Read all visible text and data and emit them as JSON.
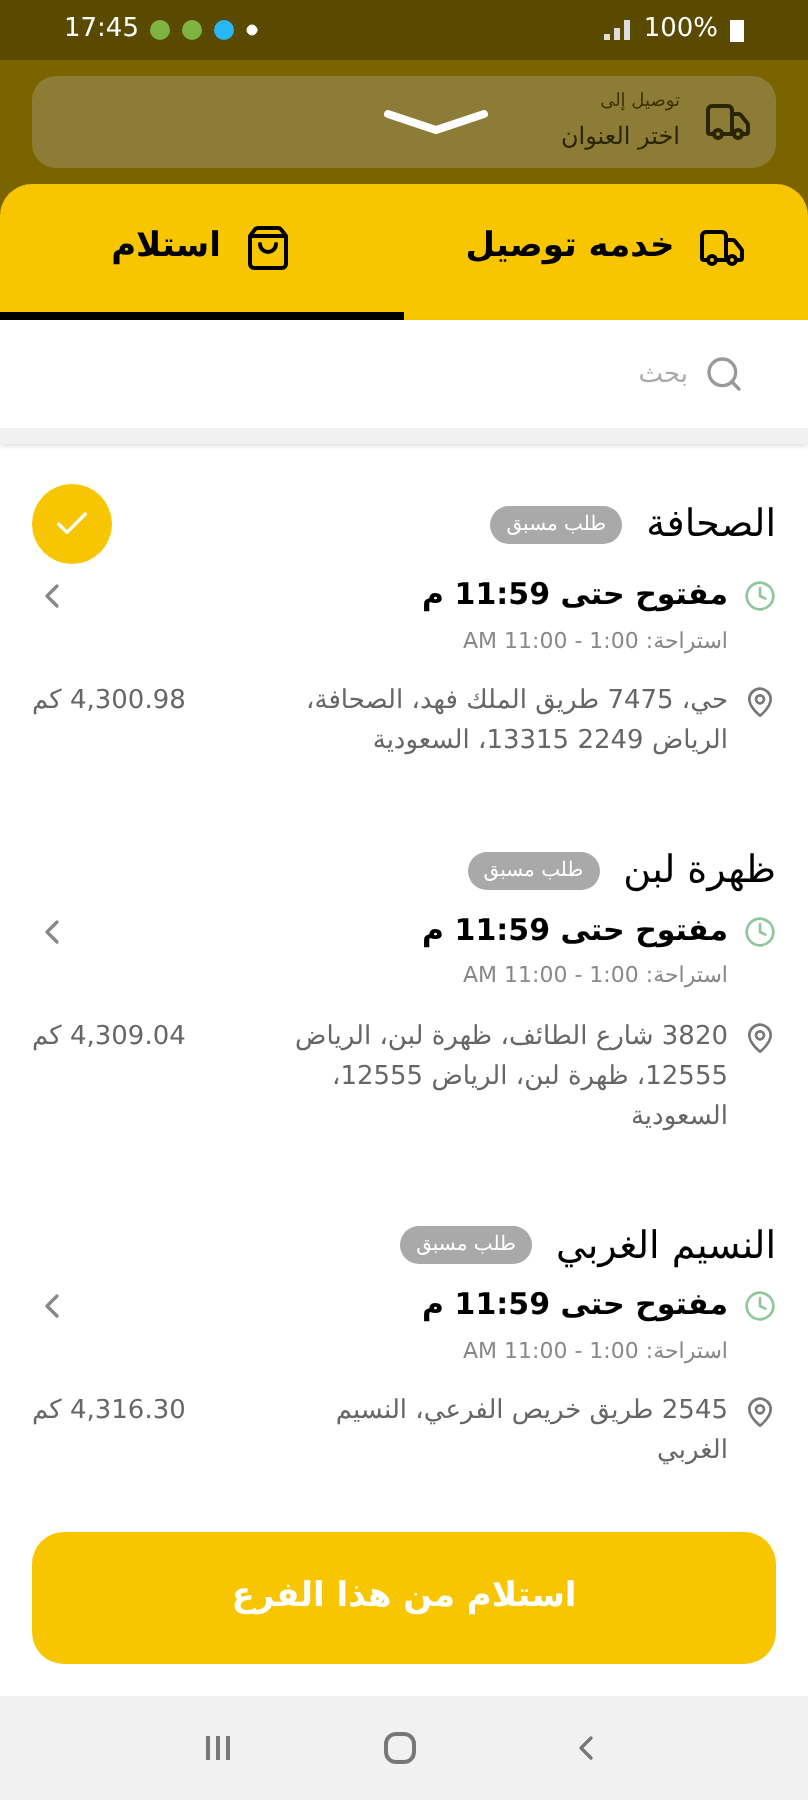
{
  "status_bar": {
    "time": "17:45",
    "battery": "100%"
  },
  "address_bar": {
    "label": "توصيل إلى",
    "value": "اختر العنوان"
  },
  "tabs": [
    {
      "label": "خدمه توصيل",
      "kind": "delivery",
      "selected": false
    },
    {
      "label": "استلام",
      "kind": "pickup",
      "selected": true
    }
  ],
  "search": {
    "placeholder": "بحث"
  },
  "branches": [
    {
      "name": "الصحافة",
      "badge": "طلب مسبق",
      "selected": true,
      "hours": "مفتوح حتى 11:59 م",
      "break": "استراحة: 1:00 - 11:00 AM",
      "address": "حي، 7475 طريق الملك فهد، الصحافة، الرياض 2249 13315، السعودية",
      "distance": "4,300.98 كم"
    },
    {
      "name": "ظهرة لبن",
      "badge": "طلب مسبق",
      "selected": false,
      "hours": "مفتوح حتى 11:59 م",
      "break": "استراحة: 1:00 - 11:00 AM",
      "address": "3820 شارع الطائف، ظهرة لبن، الرياض 12555، ظهرة لبن، الرياض 12555، السعودية",
      "distance": "4,309.04 كم"
    },
    {
      "name": "النسيم الغربي",
      "badge": "طلب مسبق",
      "selected": false,
      "hours": "مفتوح حتى 11:59 م",
      "break": "استراحة: 1:00 - 11:00 AM",
      "address": "2545 طريق خريص الفرعي، النسيم الغربي",
      "distance": "4,316.30 كم"
    }
  ],
  "action_button": "استلام من هذا الفرع"
}
